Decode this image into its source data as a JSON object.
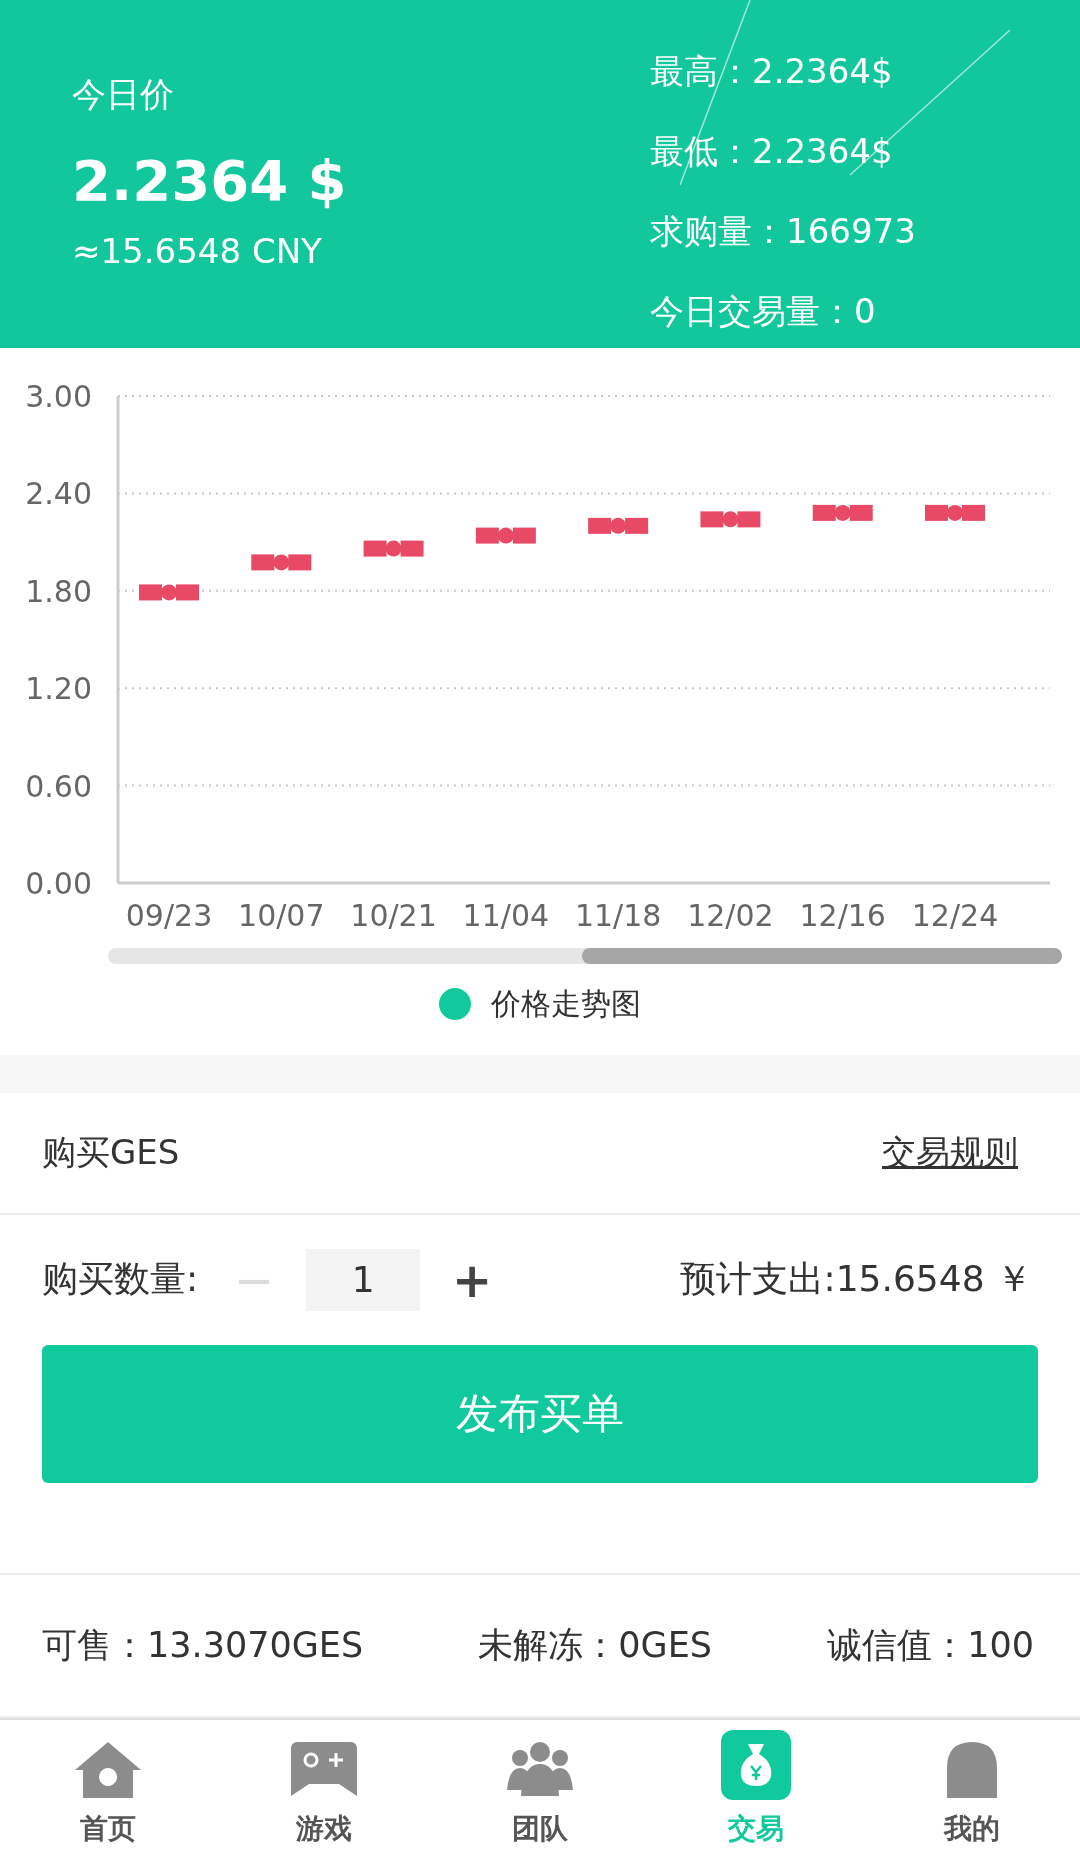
{
  "header": {
    "label": "今日价",
    "price": "2.2364 $",
    "approx": "≈15.6548 CNY",
    "stats": [
      {
        "label": "最高：",
        "value": "2.2364$"
      },
      {
        "label": "最低：",
        "value": "2.2364$"
      },
      {
        "label": "求购量：",
        "value": "166973"
      },
      {
        "label": "今日交易量：",
        "value": "0"
      }
    ]
  },
  "chart": {
    "chart_data": {
      "type": "scatter",
      "grid": true,
      "categories": [
        "09/23",
        "10/07",
        "10/21",
        "11/04",
        "11/18",
        "12/02",
        "12/16",
        "12/24"
      ],
      "series": [
        {
          "name": "价格走势图",
          "color": "#e84a66",
          "values": [
            1.79,
            1.975,
            2.06,
            2.14,
            2.2,
            2.24,
            2.28,
            2.28
          ]
        }
      ],
      "ylim": [
        0,
        3
      ],
      "yticks": [
        {
          "value": 0,
          "label": "0.00"
        },
        {
          "value": 0.6,
          "label": "0.60"
        },
        {
          "value": 1.2,
          "label": "1.20"
        },
        {
          "value": 1.8,
          "label": "1.80"
        },
        {
          "value": 2.4,
          "label": "2.40"
        },
        {
          "value": 3,
          "label": "3.00"
        }
      ]
    }
  },
  "buy": {
    "title": "购买GES",
    "rules_link": "交易规则",
    "quantity_label": "购买数量:",
    "decrement": {
      "label": "−",
      "disabled": true
    },
    "quantity": "1",
    "increment": {
      "label": "+",
      "disabled": false
    },
    "estimate": "预计支出:15.6548 ￥",
    "submit": "发布买单"
  },
  "balances": [
    {
      "label": "可售：",
      "value": "13.3070GES"
    },
    {
      "label": "未解冻：",
      "value": "0GES"
    },
    {
      "label": "诚信值：",
      "value": "100"
    }
  ],
  "nav": [
    {
      "label": "首页",
      "selected": false
    },
    {
      "label": "游戏",
      "selected": false
    },
    {
      "label": "团队",
      "selected": false
    },
    {
      "label": "交易",
      "selected": true
    },
    {
      "label": "我的",
      "selected": false
    }
  ]
}
